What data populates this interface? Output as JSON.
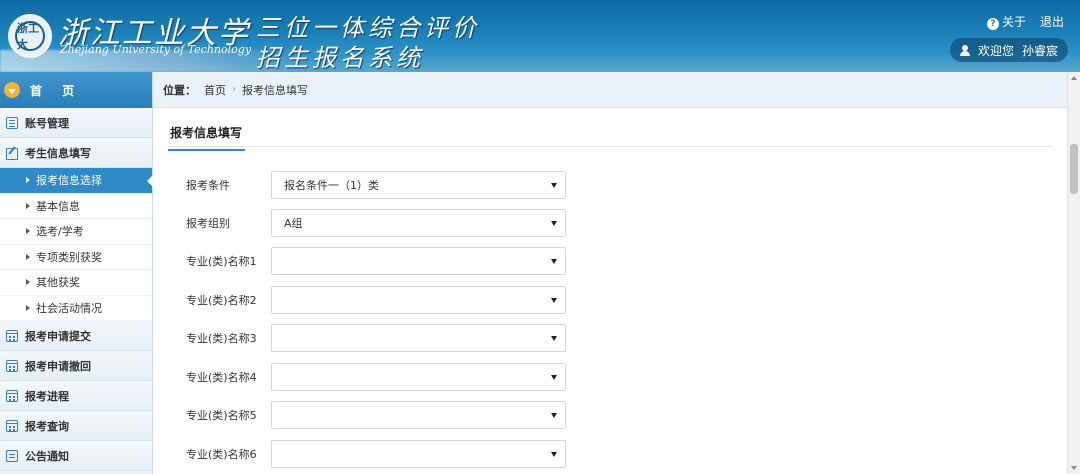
{
  "header": {
    "logo_text": "浙工大",
    "university_cn": "浙江工业大学",
    "university_en": "Zhejiang University of Technology",
    "system_title_line1": "三位一体综合评价",
    "system_title_line2": "招生报名系统",
    "about_label": "关于",
    "logout_label": "退出",
    "welcome_label": "欢迎您",
    "user_name": "孙睿宸"
  },
  "sidebar": {
    "home_label": "首 页",
    "account_label": "账号管理",
    "info_section_label": "考生信息填写",
    "sub_items": [
      {
        "label": "报考信息选择"
      },
      {
        "label": "基本信息"
      },
      {
        "label": "选考/学考"
      },
      {
        "label": "专项类别获奖"
      },
      {
        "label": "其他获奖"
      },
      {
        "label": "社会活动情况"
      }
    ],
    "items_after": [
      {
        "label": "报考申请提交"
      },
      {
        "label": "报考申请撤回"
      },
      {
        "label": "报考进程"
      },
      {
        "label": "报考查询"
      },
      {
        "label": "公告通知"
      }
    ]
  },
  "breadcrumb": {
    "prefix": "位置：",
    "home": "首页",
    "current": "报考信息填写"
  },
  "main": {
    "section_title": "报考信息填写",
    "fields": [
      {
        "label": "报考条件",
        "value": "报名条件一（1）类"
      },
      {
        "label": "报考组别",
        "value": "A组"
      },
      {
        "label": "专业(类)名称1",
        "value": ""
      },
      {
        "label": "专业(类)名称2",
        "value": ""
      },
      {
        "label": "专业(类)名称3",
        "value": ""
      },
      {
        "label": "专业(类)名称4",
        "value": ""
      },
      {
        "label": "专业(类)名称5",
        "value": ""
      },
      {
        "label": "专业(类)名称6",
        "value": ""
      }
    ]
  },
  "colors": {
    "header_blue": "#1a80b8",
    "active_blue": "#2f8ac6",
    "sidebar_bg": "#eaf1f8"
  }
}
